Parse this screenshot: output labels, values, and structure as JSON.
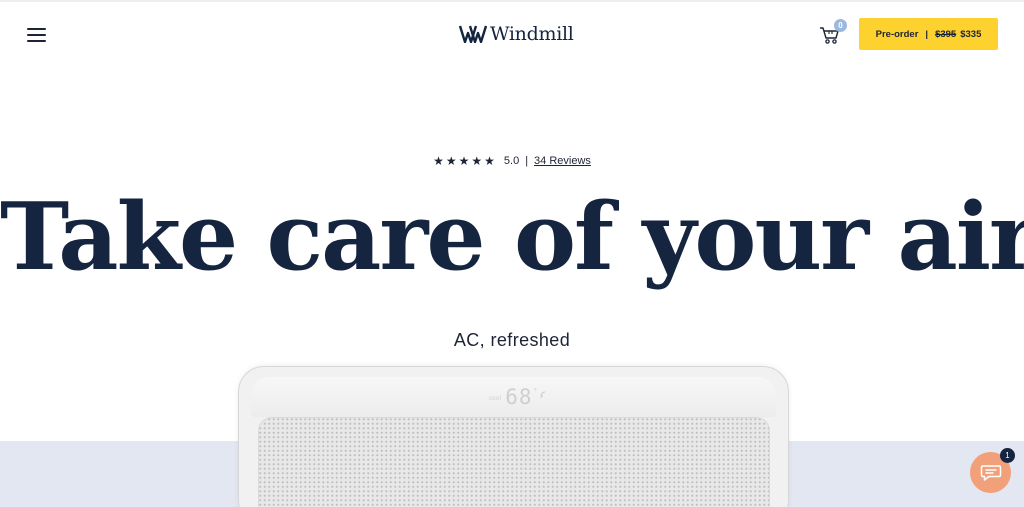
{
  "header": {
    "menu_label": "Menu",
    "logo_text": "Windmill",
    "cart_count": "0",
    "preorder": {
      "label": "Pre-order",
      "separator": "|",
      "old_price": "$395",
      "new_price": "$335"
    }
  },
  "hero": {
    "stars": "★★★★★",
    "rating_value": "5.0",
    "rating_separator": "|",
    "reviews_link": "34 Reviews",
    "headline": "Take care of your air",
    "subheadline": "AC, refreshed"
  },
  "product": {
    "display_mode": "cool",
    "display_temp": "68",
    "display_degree": "°"
  },
  "chat": {
    "unread_count": "1"
  },
  "colors": {
    "brand_navy": "#15243f",
    "cta_yellow": "#fdd22f",
    "floor_lavender": "#e3e7f2",
    "chat_orange": "#f2a07a",
    "cart_badge_blue": "#9db8df"
  },
  "icons": [
    "menu-icon",
    "windmill-logo-icon",
    "cart-icon",
    "star-icon",
    "wifi-icon",
    "chat-icon"
  ]
}
